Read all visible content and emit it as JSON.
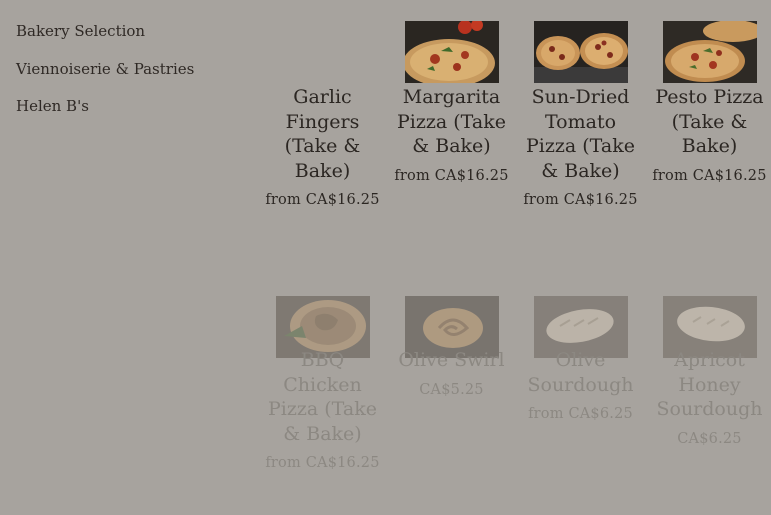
{
  "sidebar": {
    "items": [
      {
        "label": "Bakery Selection"
      },
      {
        "label": "Viennoiserie & Pastries"
      },
      {
        "label": "Helen B's"
      }
    ]
  },
  "products": [
    {
      "name": "Garlic Fingers (Take & Bake)",
      "price": "from CA$16.25",
      "image": "none"
    },
    {
      "name": "Margarita Pizza (Take & Bake)",
      "price": "from CA$16.25",
      "image": "margarita-pizza"
    },
    {
      "name": "Sun-Dried Tomato Pizza (Take & Bake)",
      "price": "from CA$16.25",
      "image": "sun-dried-tomato-pizza"
    },
    {
      "name": "Pesto Pizza (Take & Bake)",
      "price": "from CA$16.25",
      "image": "pesto-pizza"
    },
    {
      "name": "BBQ Chicken Pizza (Take & Bake)",
      "price": "from CA$16.25",
      "image": "bbq-chicken-pizza"
    },
    {
      "name": "Olive Swirl",
      "price": "CA$5.25",
      "image": "olive-swirl"
    },
    {
      "name": "Olive Sourdough",
      "price": "from CA$6.25",
      "image": "olive-sourdough"
    },
    {
      "name": "Apricot Honey Sourdough",
      "price": "CA$6.25",
      "image": "apricot-honey-sourdough"
    }
  ]
}
